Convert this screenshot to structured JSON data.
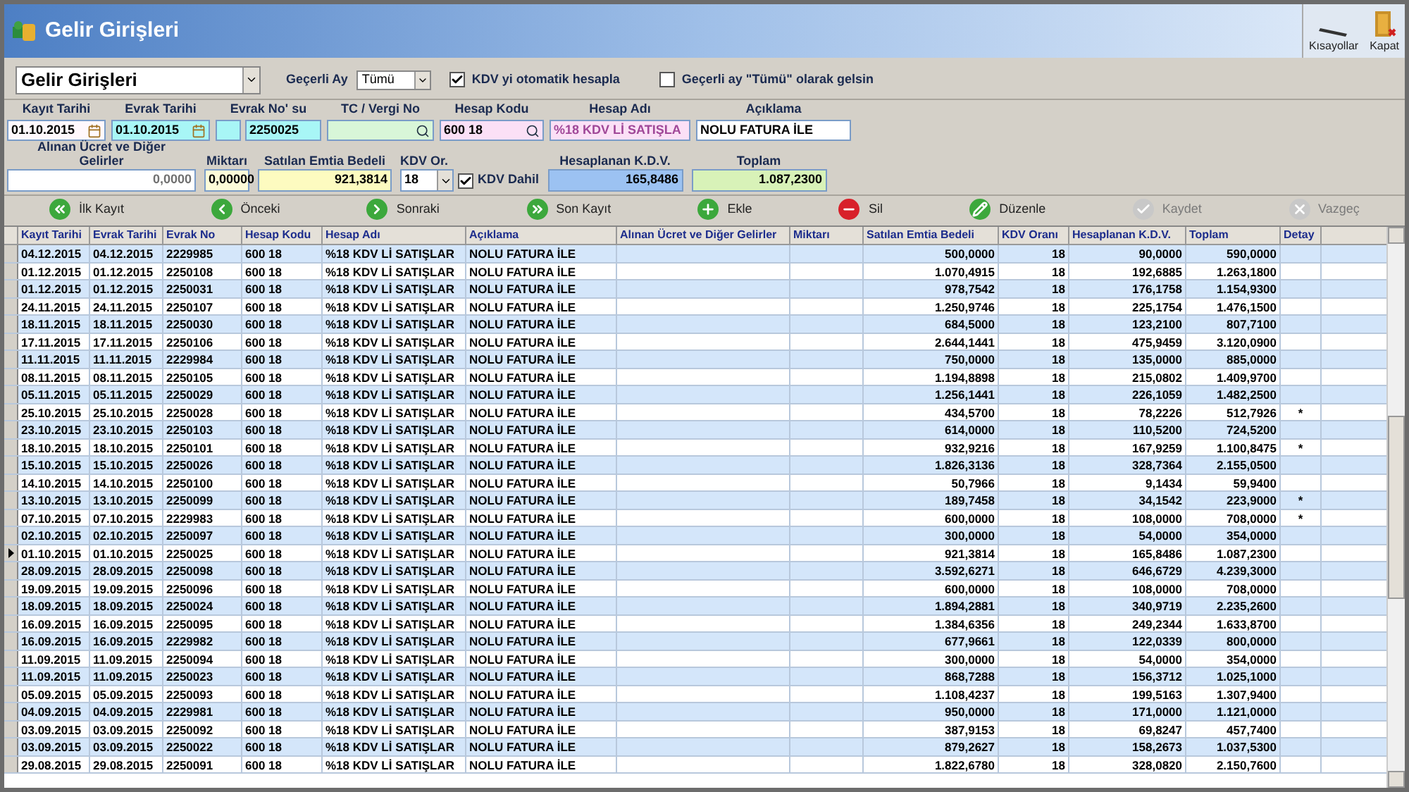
{
  "window": {
    "title": "Gelir Girişleri"
  },
  "top_tools": [
    {
      "kind": "shortcuts",
      "label": "Kısayollar"
    },
    {
      "kind": "close",
      "label": "Kapat"
    }
  ],
  "header": {
    "module": "Gelir Girişleri",
    "month_label": "Geçerli Ay",
    "month_value": "Tümü",
    "options": [
      {
        "label": "KDV yi otomatik hesapla",
        "checked": true
      },
      {
        "label": "Geçerli ay \"Tümü\" olarak gelsin",
        "checked": false
      }
    ]
  },
  "fields_row1": [
    {
      "label": "Kayıt Tarihi",
      "kind": "date",
      "value": "01.10.2015"
    },
    {
      "label": "Evrak Tarihi",
      "kind": "date",
      "value": "01.10.2015"
    },
    {
      "label": "Evrak No' su",
      "kind": "docno",
      "value": "2250025"
    },
    {
      "label": "TC / Vergi No",
      "kind": "lookup"
    },
    {
      "label": "Hesap Kodu",
      "kind": "lookup",
      "value": "600 18"
    },
    {
      "label": "Hesap Adı",
      "kind": "text",
      "value": "%18 KDV Lİ SATIŞLA"
    },
    {
      "label": "Açıklama",
      "kind": "text",
      "value": "NOLU FATURA İLE"
    }
  ],
  "fields_row2": [
    {
      "label": "Alınan Ücret ve Diğer Gelirler",
      "kind": "number",
      "value": "0,0000"
    },
    {
      "label": "Miktarı",
      "kind": "number",
      "value": "0,00000"
    },
    {
      "label": "Satılan Emtia Bedeli",
      "kind": "number",
      "value": "921,3814"
    },
    {
      "label": "KDV Or.",
      "kind": "select",
      "value": "18",
      "check_label": "KDV Dahil",
      "checked": true
    },
    {
      "label": "Hesaplanan K.D.V.",
      "kind": "number",
      "value": "165,8486"
    },
    {
      "label": "Toplam",
      "kind": "number",
      "value": "1.087,2300"
    }
  ],
  "nav_buttons": [
    {
      "kind": "first",
      "label": "İlk Kayıt",
      "disabled": false
    },
    {
      "kind": "prev",
      "label": "Önceki",
      "disabled": false
    },
    {
      "kind": "next",
      "label": "Sonraki",
      "disabled": false
    },
    {
      "kind": "last",
      "label": "Son Kayıt",
      "disabled": false
    },
    {
      "kind": "add",
      "label": "Ekle",
      "disabled": false
    },
    {
      "kind": "delete",
      "label": "Sil",
      "disabled": false
    },
    {
      "kind": "edit",
      "label": "Düzenle",
      "disabled": false
    },
    {
      "kind": "save",
      "label": "Kaydet",
      "disabled": true
    },
    {
      "kind": "cancel",
      "label": "Vazgeç",
      "disabled": true
    }
  ],
  "table": {
    "columns": [
      "Kayıt Tarihi",
      "Evrak Tarihi",
      "Evrak No",
      "Hesap Kodu",
      "Hesap Adı",
      "Açıklama",
      "Alınan Ücret ve Diğer Gelirler",
      "Miktarı",
      "Satılan Emtia Bedeli",
      "KDV Oranı",
      "Hesaplanan K.D.V.",
      "Toplam",
      "Detay"
    ],
    "rows": [
      {
        "selected": false,
        "cells": [
          "04.12.2015",
          "04.12.2015",
          "2229985",
          "600 18",
          "%18 KDV Lİ SATIŞLAR",
          "NOLU FATURA İLE",
          null,
          null,
          "500,0000",
          "18",
          "90,0000",
          "590,0000",
          null
        ]
      },
      {
        "selected": false,
        "cells": [
          "01.12.2015",
          "01.12.2015",
          "2250108",
          "600 18",
          "%18 KDV Lİ SATIŞLAR",
          "NOLU FATURA İLE",
          null,
          null,
          "1.070,4915",
          "18",
          "192,6885",
          "1.263,1800",
          null
        ]
      },
      {
        "selected": false,
        "cells": [
          "01.12.2015",
          "01.12.2015",
          "2250031",
          "600 18",
          "%18 KDV Lİ SATIŞLAR",
          "NOLU FATURA İLE",
          null,
          null,
          "978,7542",
          "18",
          "176,1758",
          "1.154,9300",
          null
        ]
      },
      {
        "selected": false,
        "cells": [
          "24.11.2015",
          "24.11.2015",
          "2250107",
          "600 18",
          "%18 KDV Lİ SATIŞLAR",
          "NOLU FATURA İLE",
          null,
          null,
          "1.250,9746",
          "18",
          "225,1754",
          "1.476,1500",
          null
        ]
      },
      {
        "selected": false,
        "cells": [
          "18.11.2015",
          "18.11.2015",
          "2250030",
          "600 18",
          "%18 KDV Lİ SATIŞLAR",
          "NOLU FATURA İLE",
          null,
          null,
          "684,5000",
          "18",
          "123,2100",
          "807,7100",
          null
        ]
      },
      {
        "selected": false,
        "cells": [
          "17.11.2015",
          "17.11.2015",
          "2250106",
          "600 18",
          "%18 KDV Lİ SATIŞLAR",
          "NOLU FATURA İLE",
          null,
          null,
          "2.644,1441",
          "18",
          "475,9459",
          "3.120,0900",
          null
        ]
      },
      {
        "selected": false,
        "cells": [
          "11.11.2015",
          "11.11.2015",
          "2229984",
          "600 18",
          "%18 KDV Lİ SATIŞLAR",
          "NOLU FATURA İLE",
          null,
          null,
          "750,0000",
          "18",
          "135,0000",
          "885,0000",
          null
        ]
      },
      {
        "selected": false,
        "cells": [
          "08.11.2015",
          "08.11.2015",
          "2250105",
          "600 18",
          "%18 KDV Lİ SATIŞLAR",
          "NOLU FATURA İLE",
          null,
          null,
          "1.194,8898",
          "18",
          "215,0802",
          "1.409,9700",
          null
        ]
      },
      {
        "selected": false,
        "cells": [
          "05.11.2015",
          "05.11.2015",
          "2250029",
          "600 18",
          "%18 KDV Lİ SATIŞLAR",
          "NOLU FATURA İLE",
          null,
          null,
          "1.256,1441",
          "18",
          "226,1059",
          "1.482,2500",
          null
        ]
      },
      {
        "selected": false,
        "cells": [
          "25.10.2015",
          "25.10.2015",
          "2250028",
          "600 18",
          "%18 KDV Lİ SATIŞLAR",
          "NOLU FATURA İLE",
          null,
          null,
          "434,5700",
          "18",
          "78,2226",
          "512,7926",
          "*"
        ]
      },
      {
        "selected": false,
        "cells": [
          "23.10.2015",
          "23.10.2015",
          "2250103",
          "600 18",
          "%18 KDV Lİ SATIŞLAR",
          "NOLU FATURA İLE",
          null,
          null,
          "614,0000",
          "18",
          "110,5200",
          "724,5200",
          null
        ]
      },
      {
        "selected": false,
        "cells": [
          "18.10.2015",
          "18.10.2015",
          "2250101",
          "600 18",
          "%18 KDV Lİ SATIŞLAR",
          "NOLU FATURA İLE",
          null,
          null,
          "932,9216",
          "18",
          "167,9259",
          "1.100,8475",
          "*"
        ]
      },
      {
        "selected": false,
        "cells": [
          "15.10.2015",
          "15.10.2015",
          "2250026",
          "600 18",
          "%18 KDV Lİ SATIŞLAR",
          "NOLU FATURA İLE",
          null,
          null,
          "1.826,3136",
          "18",
          "328,7364",
          "2.155,0500",
          null
        ]
      },
      {
        "selected": false,
        "cells": [
          "14.10.2015",
          "14.10.2015",
          "2250100",
          "600 18",
          "%18 KDV Lİ SATIŞLAR",
          "NOLU FATURA İLE",
          null,
          null,
          "50,7966",
          "18",
          "9,1434",
          "59,9400",
          null
        ]
      },
      {
        "selected": false,
        "cells": [
          "13.10.2015",
          "13.10.2015",
          "2250099",
          "600 18",
          "%18 KDV Lİ SATIŞLAR",
          "NOLU FATURA İLE",
          null,
          null,
          "189,7458",
          "18",
          "34,1542",
          "223,9000",
          "*"
        ]
      },
      {
        "selected": false,
        "cells": [
          "07.10.2015",
          "07.10.2015",
          "2229983",
          "600 18",
          "%18 KDV Lİ SATIŞLAR",
          "NOLU FATURA İLE",
          null,
          null,
          "600,0000",
          "18",
          "108,0000",
          "708,0000",
          "*"
        ]
      },
      {
        "selected": false,
        "cells": [
          "02.10.2015",
          "02.10.2015",
          "2250097",
          "600 18",
          "%18 KDV Lİ SATIŞLAR",
          "NOLU FATURA İLE",
          null,
          null,
          "300,0000",
          "18",
          "54,0000",
          "354,0000",
          null
        ]
      },
      {
        "selected": true,
        "cells": [
          "01.10.2015",
          "01.10.2015",
          "2250025",
          "600 18",
          "%18 KDV Lİ SATIŞLAR",
          "NOLU FATURA İLE",
          null,
          null,
          "921,3814",
          "18",
          "165,8486",
          "1.087,2300",
          null
        ]
      },
      {
        "selected": false,
        "cells": [
          "28.09.2015",
          "28.09.2015",
          "2250098",
          "600 18",
          "%18 KDV Lİ SATIŞLAR",
          "NOLU FATURA İLE",
          null,
          null,
          "3.592,6271",
          "18",
          "646,6729",
          "4.239,3000",
          null
        ]
      },
      {
        "selected": false,
        "cells": [
          "19.09.2015",
          "19.09.2015",
          "2250096",
          "600 18",
          "%18 KDV Lİ SATIŞLAR",
          "NOLU FATURA İLE",
          null,
          null,
          "600,0000",
          "18",
          "108,0000",
          "708,0000",
          null
        ]
      },
      {
        "selected": false,
        "cells": [
          "18.09.2015",
          "18.09.2015",
          "2250024",
          "600 18",
          "%18 KDV Lİ SATIŞLAR",
          "NOLU FATURA İLE",
          null,
          null,
          "1.894,2881",
          "18",
          "340,9719",
          "2.235,2600",
          null
        ]
      },
      {
        "selected": false,
        "cells": [
          "16.09.2015",
          "16.09.2015",
          "2250095",
          "600 18",
          "%18 KDV Lİ SATIŞLAR",
          "NOLU FATURA İLE",
          null,
          null,
          "1.384,6356",
          "18",
          "249,2344",
          "1.633,8700",
          null
        ]
      },
      {
        "selected": false,
        "cells": [
          "16.09.2015",
          "16.09.2015",
          "2229982",
          "600 18",
          "%18 KDV Lİ SATIŞLAR",
          "NOLU FATURA İLE",
          null,
          null,
          "677,9661",
          "18",
          "122,0339",
          "800,0000",
          null
        ]
      },
      {
        "selected": false,
        "cells": [
          "11.09.2015",
          "11.09.2015",
          "2250094",
          "600 18",
          "%18 KDV Lİ SATIŞLAR",
          "NOLU FATURA İLE",
          null,
          null,
          "300,0000",
          "18",
          "54,0000",
          "354,0000",
          null
        ]
      },
      {
        "selected": false,
        "cells": [
          "11.09.2015",
          "11.09.2015",
          "2250023",
          "600 18",
          "%18 KDV Lİ SATIŞLAR",
          "NOLU FATURA İLE",
          null,
          null,
          "868,7288",
          "18",
          "156,3712",
          "1.025,1000",
          null
        ]
      },
      {
        "selected": false,
        "cells": [
          "05.09.2015",
          "05.09.2015",
          "2250093",
          "600 18",
          "%18 KDV Lİ SATIŞLAR",
          "NOLU FATURA İLE",
          null,
          null,
          "1.108,4237",
          "18",
          "199,5163",
          "1.307,9400",
          null
        ]
      },
      {
        "selected": false,
        "cells": [
          "04.09.2015",
          "04.09.2015",
          "2229981",
          "600 18",
          "%18 KDV Lİ SATIŞLAR",
          "NOLU FATURA İLE",
          null,
          null,
          "950,0000",
          "18",
          "171,0000",
          "1.121,0000",
          null
        ]
      },
      {
        "selected": false,
        "cells": [
          "03.09.2015",
          "03.09.2015",
          "2250092",
          "600 18",
          "%18 KDV Lİ SATIŞLAR",
          "NOLU FATURA İLE",
          null,
          null,
          "387,9153",
          "18",
          "69,8247",
          "457,7400",
          null
        ]
      },
      {
        "selected": false,
        "cells": [
          "03.09.2015",
          "03.09.2015",
          "2250022",
          "600 18",
          "%18 KDV Lİ SATIŞLAR",
          "NOLU FATURA İLE",
          null,
          null,
          "879,2627",
          "18",
          "158,2673",
          "1.037,5300",
          null
        ]
      },
      {
        "selected": false,
        "cells": [
          "29.08.2015",
          "29.08.2015",
          "2250091",
          "600 18",
          "%18 KDV Lİ SATIŞLAR",
          "NOLU FATURA İLE",
          null,
          null,
          "1.822,6780",
          "18",
          "328,0820",
          "2.150,7600",
          null
        ]
      }
    ]
  }
}
